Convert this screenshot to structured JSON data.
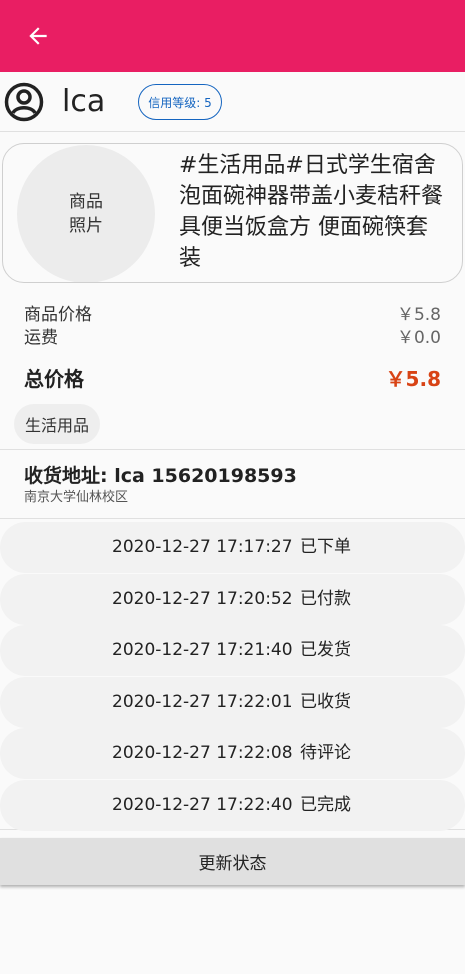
{
  "appbar": {
    "back_icon": "arrow-left-icon",
    "color": "#e91e63"
  },
  "user": {
    "icon": "account-circle-icon",
    "name": "lca",
    "credit_badge": "信用等级: 5"
  },
  "product": {
    "photo_line1": "商品",
    "photo_line2": "照片",
    "title": "#生活用品#日式学生宿舍泡面碗神器带盖小麦秸秆餐具便当饭盒方 便面碗筷套装"
  },
  "pricing": {
    "price_label": "商品价格",
    "price_value": "￥5.8",
    "shipping_label": "运费",
    "shipping_value": "￥0.0",
    "total_label": "总价格",
    "total_value": "￥5.8",
    "total_color": "#d84315"
  },
  "category": {
    "label": "生活用品"
  },
  "address": {
    "main": "收货地址:  lca 15620198593",
    "detail": "南京大学仙林校区"
  },
  "status_history": [
    {
      "time": "2020-12-27 17:17:27",
      "status": "已下单"
    },
    {
      "time": "2020-12-27 17:20:52",
      "status": "已付款"
    },
    {
      "time": "2020-12-27 17:21:40",
      "status": "已发货"
    },
    {
      "time": "2020-12-27 17:22:01",
      "status": "已收货"
    },
    {
      "time": "2020-12-27 17:22:08",
      "status": "待评论"
    },
    {
      "time": "2020-12-27 17:22:40",
      "status": "已完成"
    }
  ],
  "actions": {
    "update_status": "更新状态"
  }
}
